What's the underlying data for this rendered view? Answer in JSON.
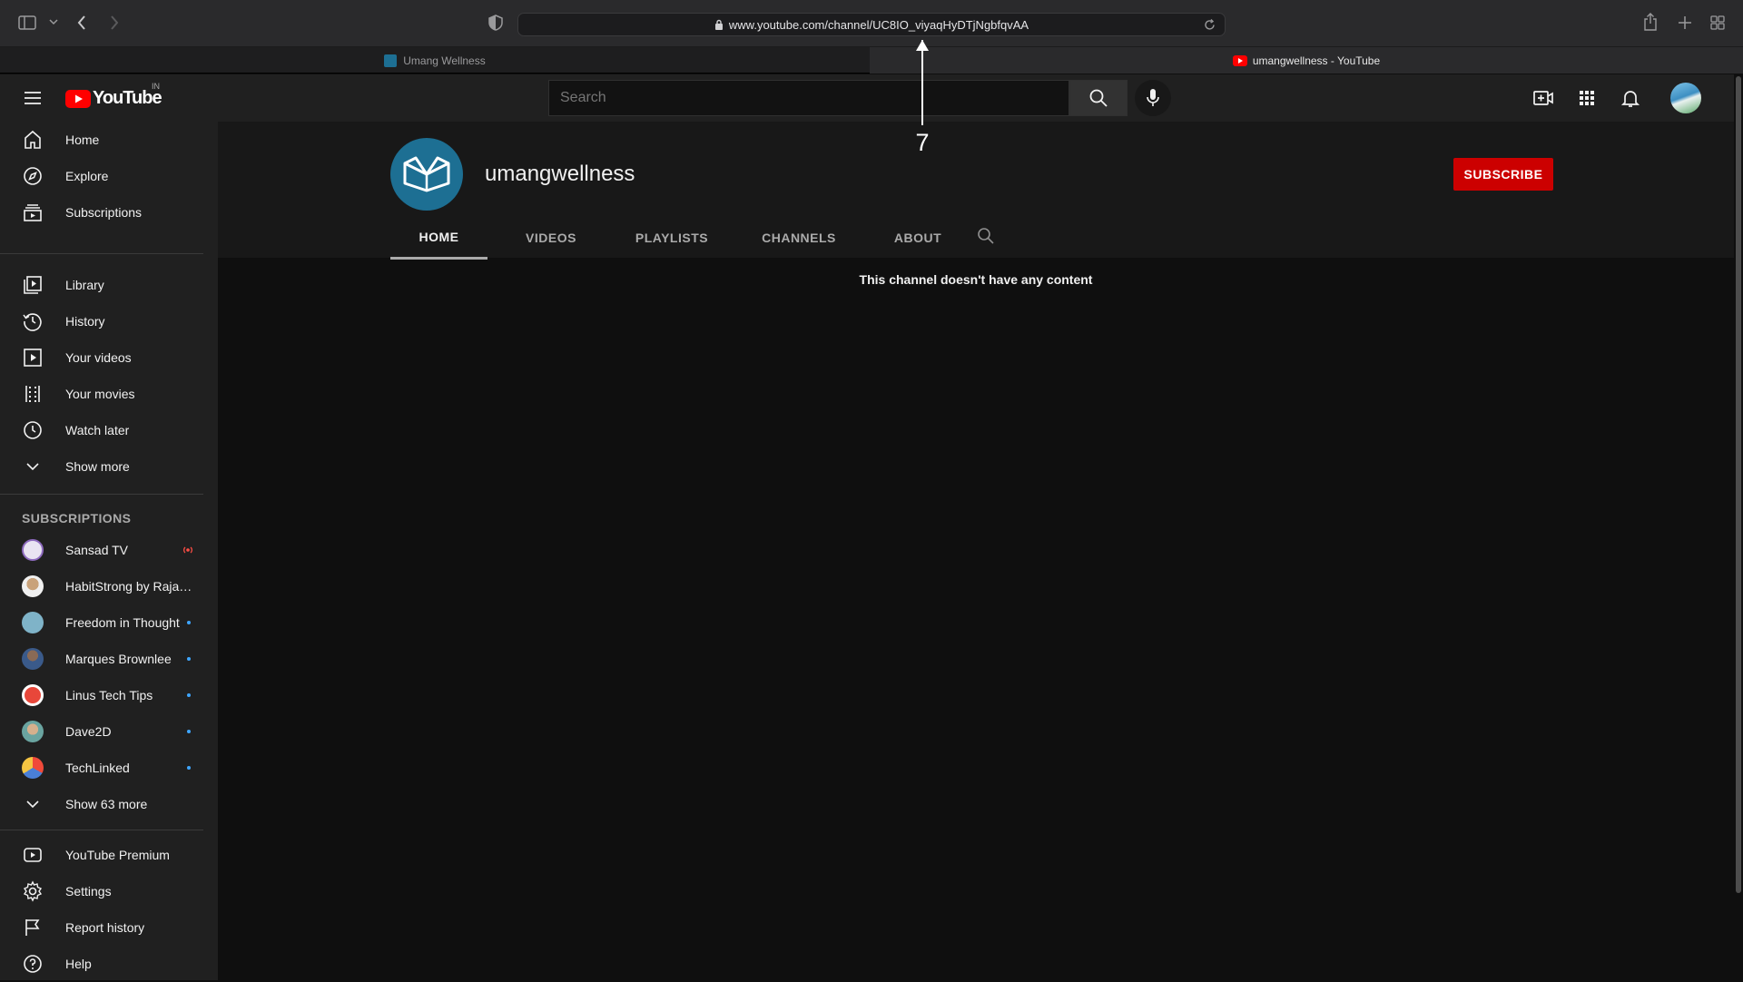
{
  "browser": {
    "url": "www.youtube.com/channel/UC8IO_viyaqHyDTjNgbfqvAA",
    "tabs": [
      {
        "title": "Umang Wellness",
        "active": false
      },
      {
        "title": "umangwellness - YouTube",
        "active": true
      }
    ]
  },
  "annotation": {
    "label": "7"
  },
  "youtube": {
    "logo_text": "YouTube",
    "region": "IN",
    "search_placeholder": "Search",
    "icons": [
      "menu-icon",
      "search-icon",
      "mic-icon",
      "create-icon",
      "apps-icon",
      "bell-icon",
      "avatar"
    ]
  },
  "sidebar": {
    "main": [
      {
        "label": "Home",
        "icon": "home-icon"
      },
      {
        "label": "Explore",
        "icon": "compass-icon"
      },
      {
        "label": "Subscriptions",
        "icon": "subscriptions-icon"
      }
    ],
    "library": [
      {
        "label": "Library",
        "icon": "library-icon"
      },
      {
        "label": "History",
        "icon": "history-icon"
      },
      {
        "label": "Your videos",
        "icon": "play-square-icon"
      },
      {
        "label": "Your movies",
        "icon": "film-icon"
      },
      {
        "label": "Watch later",
        "icon": "clock-icon"
      },
      {
        "label": "Show more",
        "icon": "chevron-down-icon"
      }
    ],
    "subscriptions_title": "SUBSCRIPTIONS",
    "subscriptions": [
      {
        "label": "Sansad TV",
        "indicator": "live",
        "color": "#8e6bbf"
      },
      {
        "label": "HabitStrong by Rajan ...",
        "indicator": "none",
        "color": "#c9a27a"
      },
      {
        "label": "Freedom in Thought",
        "indicator": "new",
        "color": "#7fb3c8"
      },
      {
        "label": "Marques Brownlee",
        "indicator": "new",
        "color": "#3a5a8a"
      },
      {
        "label": "Linus Tech Tips",
        "indicator": "new",
        "color": "#e8473a"
      },
      {
        "label": "Dave2D",
        "indicator": "new",
        "color": "#6aa4a0"
      },
      {
        "label": "TechLinked",
        "indicator": "new",
        "color": "#4a7fd6"
      }
    ],
    "show_more_subs": "Show 63 more",
    "bottom": [
      {
        "label": "YouTube Premium",
        "icon": "youtube-premium-icon"
      },
      {
        "label": "Settings",
        "icon": "gear-icon"
      },
      {
        "label": "Report history",
        "icon": "flag-icon"
      },
      {
        "label": "Help",
        "icon": "help-icon"
      }
    ]
  },
  "channel": {
    "name": "umangwellness",
    "subscribe_label": "SUBSCRIBE",
    "tabs": [
      "HOME",
      "VIDEOS",
      "PLAYLISTS",
      "CHANNELS",
      "ABOUT"
    ],
    "active_tab": "HOME",
    "empty_message": "This channel doesn't have any content"
  },
  "colors": {
    "subscribe_red": "#cc0000",
    "avatar_blue": "#1d6f93",
    "live_red": "#ff4e45",
    "new_dot": "#3ea6ff"
  }
}
